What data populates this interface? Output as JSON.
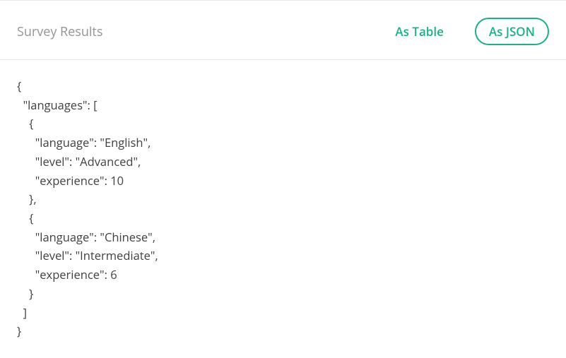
{
  "header": {
    "title": "Survey Results",
    "tabs": [
      {
        "label": "As Table",
        "active": false
      },
      {
        "label": "As JSON",
        "active": true
      }
    ]
  },
  "result_json": {
    "languages": [
      {
        "language": "English",
        "level": "Advanced",
        "experience": 10
      },
      {
        "language": "Chinese",
        "level": "Intermediate",
        "experience": 6
      }
    ]
  }
}
